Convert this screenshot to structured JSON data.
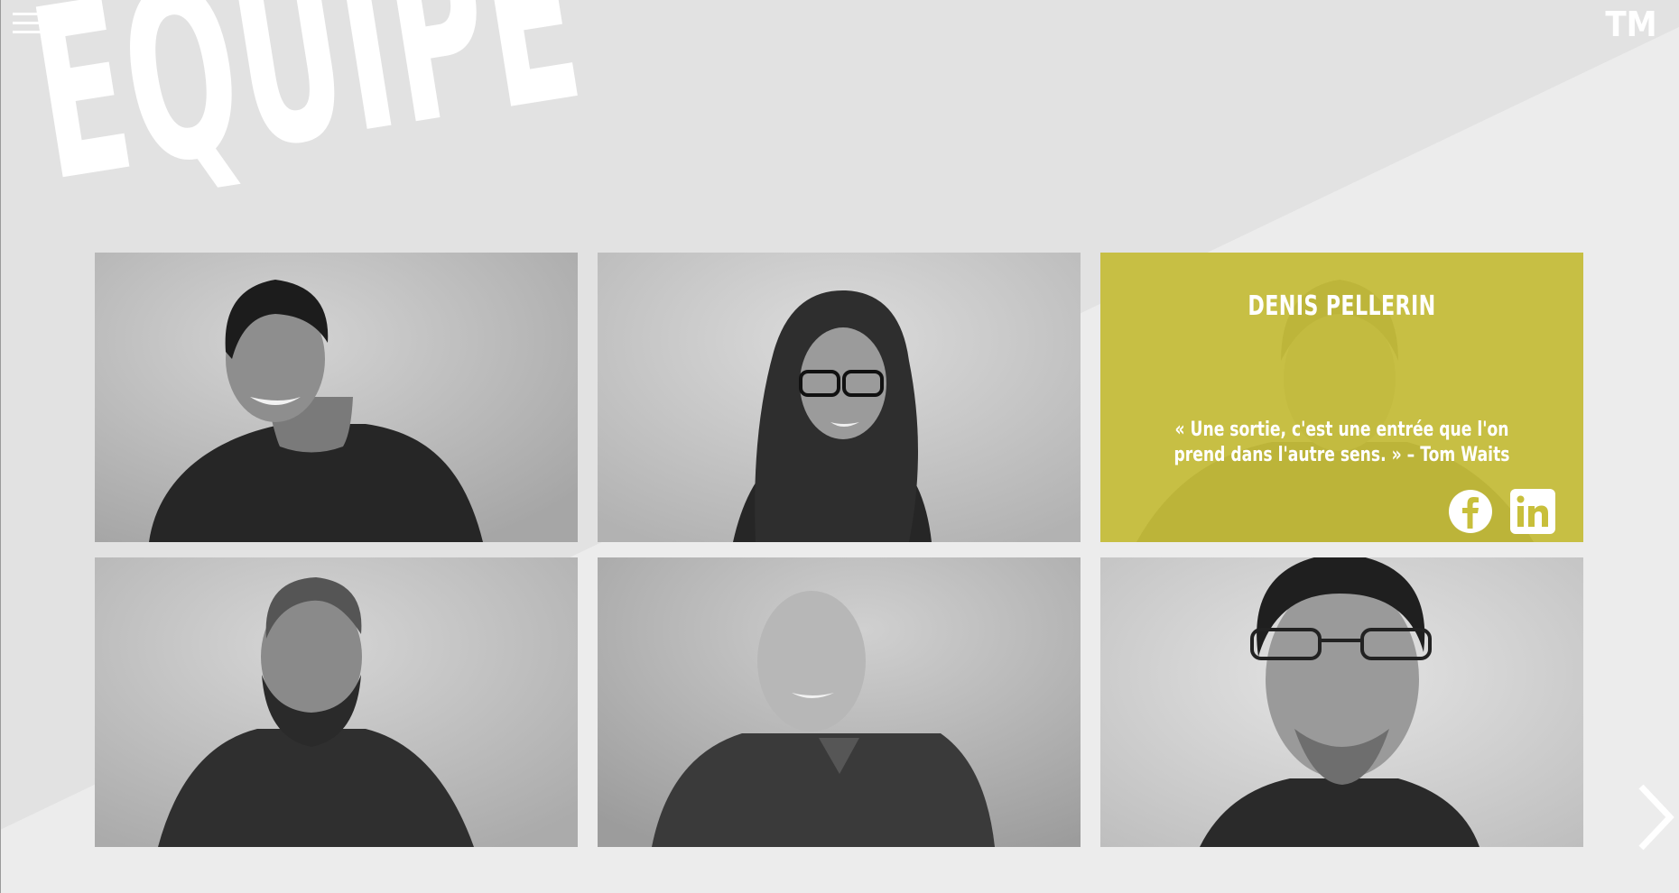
{
  "header": {
    "menu_icon": "hamburger-menu-icon",
    "logo_text": "TM",
    "title": "ÉQUIPE"
  },
  "team": {
    "members": [
      {
        "photo": "team-member-photo-1"
      },
      {
        "photo": "team-member-photo-2"
      },
      {
        "photo": "team-member-photo-3",
        "name": "DENIS PELLERIN",
        "quote": "« Une sortie, c'est une entrée que l'on prend dans l'autre sens. » – Tom Waits",
        "social": [
          "facebook-icon",
          "linkedin-icon"
        ]
      },
      {
        "photo": "team-member-photo-4"
      },
      {
        "photo": "team-member-photo-5"
      },
      {
        "photo": "team-member-photo-6"
      }
    ],
    "highlight_color": "#c8bf3b"
  },
  "navigation": {
    "next_icon": "chevron-right-icon"
  }
}
